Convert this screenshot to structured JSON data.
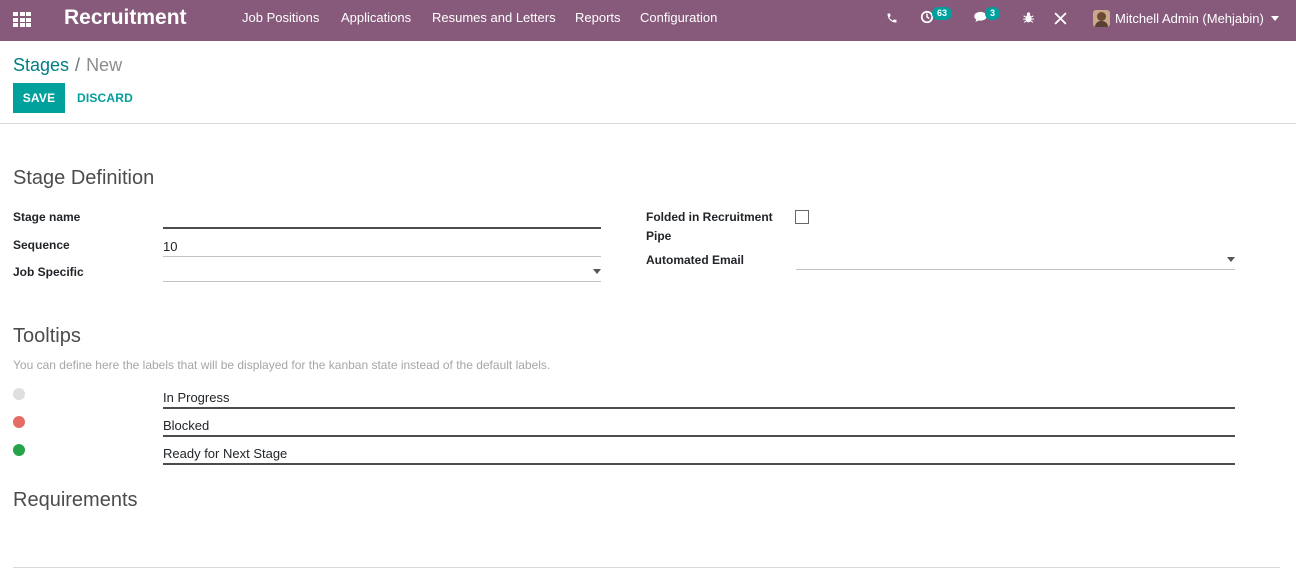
{
  "navbar": {
    "brand": "Recruitment",
    "menu": [
      "Job Positions",
      "Applications",
      "Resumes and Letters",
      "Reports",
      "Configuration"
    ],
    "activities_count": "63",
    "messages_count": "3",
    "user_name": "Mitchell Admin (Mehjabin)",
    "icons": [
      "apps-grid-icon",
      "phone-icon",
      "activity-clock-icon",
      "chat-icon",
      "bug-icon",
      "tools-icon"
    ],
    "color": "#875a7b"
  },
  "control_panel": {
    "breadcrumb_parent": "Stages",
    "breadcrumb_separator": "/",
    "breadcrumb_current": "New",
    "save_label": "SAVE",
    "discard_label": "DISCARD",
    "accent_color": "#00a09d"
  },
  "form": {
    "stage_definition": {
      "title": "Stage Definition",
      "stage_name_label": "Stage name",
      "stage_name_value": "",
      "sequence_label": "Sequence",
      "sequence_value": "10",
      "job_specific_label": "Job Specific",
      "job_specific_value": "",
      "folded_label_1": "Folded in Recruitment",
      "folded_label_2": "Pipe",
      "folded_checked": false,
      "automated_email_label": "Automated Email",
      "automated_email_value": ""
    },
    "tooltips": {
      "title": "Tooltips",
      "help": "You can define here the labels that will be displayed for the kanban state instead of the default labels.",
      "items": [
        {
          "label": "In Progress",
          "color": "#dde0de"
        },
        {
          "label": "Blocked",
          "color": "#e56b65"
        },
        {
          "label": "Ready for Next Stage",
          "color": "#28a24b"
        }
      ]
    },
    "requirements": {
      "title": "Requirements"
    }
  }
}
